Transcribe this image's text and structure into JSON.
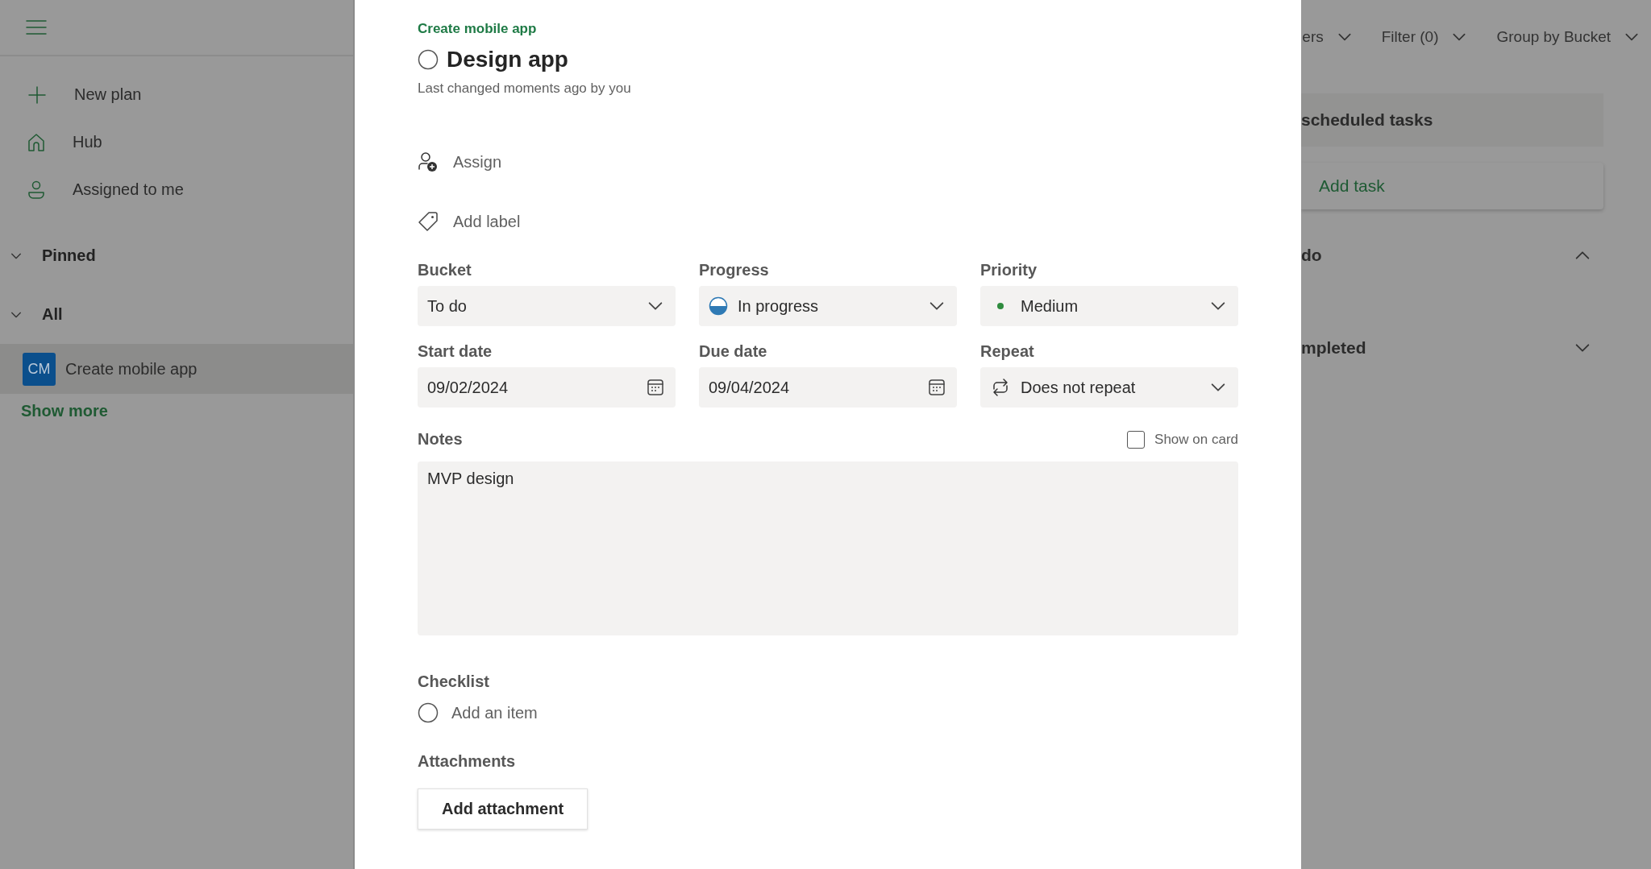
{
  "sidebar": {
    "nav": [
      {
        "kind": "plus",
        "label": "New plan"
      },
      {
        "kind": "home",
        "label": "Hub"
      },
      {
        "kind": "person",
        "label": "Assigned to me"
      }
    ],
    "sections": [
      {
        "label": "Pinned",
        "expanded": true
      },
      {
        "label": "All",
        "expanded": true,
        "plans": [
          {
            "initials": "CM",
            "name": "Create mobile app",
            "selected": true
          }
        ]
      }
    ],
    "show_more": "Show more"
  },
  "board": {
    "toolbar": [
      {
        "label": "ers"
      },
      {
        "label": "Filter (0)"
      },
      {
        "label": "Group by Bucket"
      }
    ],
    "column_title": "scheduled tasks",
    "add_task": "Add task",
    "groups": [
      {
        "label": "do",
        "expanded": true
      },
      {
        "label": "mpleted",
        "expanded": false
      }
    ]
  },
  "task": {
    "plan": "Create mobile app",
    "title": "Design app",
    "completed": false,
    "last_changed": "Last changed moments ago by you",
    "assign": "Assign",
    "add_label": "Add label",
    "fields": [
      {
        "kind": "dropdown",
        "label": "Bucket",
        "value": "To do"
      },
      {
        "kind": "progress",
        "label": "Progress",
        "value": "In progress"
      },
      {
        "kind": "priority",
        "label": "Priority",
        "value": "Medium"
      },
      {
        "kind": "date",
        "label": "Start date",
        "value": "09/02/2024"
      },
      {
        "kind": "date",
        "label": "Due date",
        "value": "09/04/2024"
      },
      {
        "kind": "repeat",
        "label": "Repeat",
        "value": "Does not repeat"
      }
    ],
    "notes": {
      "label": "Notes",
      "show_on_card": {
        "label": "Show on card",
        "checked": false
      },
      "value": "MVP design"
    },
    "checklist": {
      "label": "Checklist",
      "placeholder": "Add an item"
    },
    "attachments": {
      "label": "Attachments",
      "button": "Add attachment"
    }
  }
}
